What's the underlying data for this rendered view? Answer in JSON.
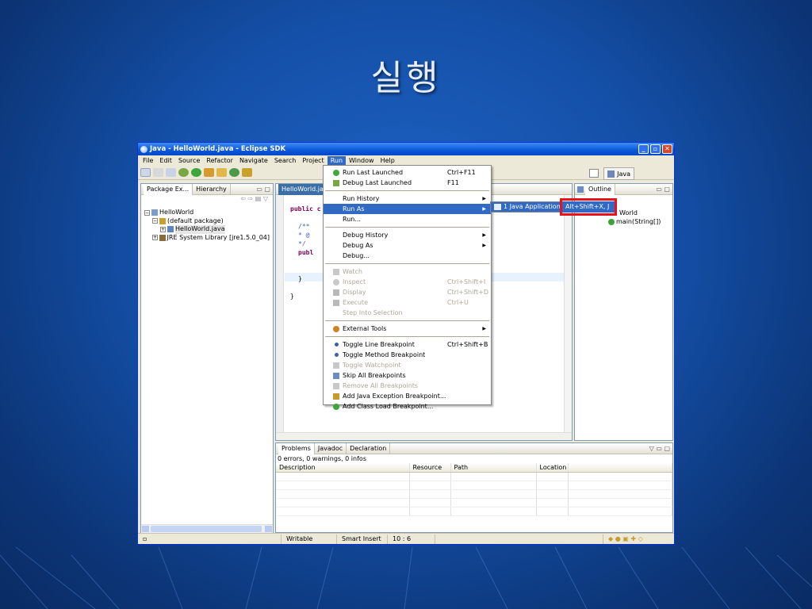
{
  "slide": {
    "title": "실행"
  },
  "window": {
    "title": "Java - HelloWorld.java - Eclipse SDK"
  },
  "menubar": [
    "File",
    "Edit",
    "Source",
    "Refactor",
    "Navigate",
    "Search",
    "Project",
    "Run",
    "Window",
    "Help"
  ],
  "perspective": {
    "label": "Java"
  },
  "package_explorer": {
    "tabs": [
      "Package Ex...",
      "Hierarchy"
    ],
    "tree": [
      {
        "label": "HelloWorld",
        "indent": 0
      },
      {
        "label": "(default package)",
        "indent": 1
      },
      {
        "label": "HelloWorld.java",
        "indent": 2
      },
      {
        "label": "JRE System Library [jre1.5.0_04]",
        "indent": 1
      }
    ]
  },
  "editor": {
    "tab": "HelloWorld.ja",
    "lines": [
      "public c",
      "",
      "/**",
      "  * @",
      "  */",
      "publ",
      "",
      "",
      "}",
      "",
      "}"
    ]
  },
  "outline": {
    "tab": "Outline",
    "items": [
      "World",
      "main(String[])"
    ]
  },
  "run_menu": [
    {
      "label": "Run Last Launched",
      "accel": "Ctrl+F11",
      "icon": "run-last-icon"
    },
    {
      "label": "Debug Last Launched",
      "accel": "F11",
      "icon": "debug-last-icon"
    },
    {
      "sep": true
    },
    {
      "label": "Run History",
      "submenu": true
    },
    {
      "label": "Run As",
      "submenu": true,
      "active": true
    },
    {
      "label": "Run..."
    },
    {
      "sep": true
    },
    {
      "label": "Debug History",
      "submenu": true
    },
    {
      "label": "Debug As",
      "submenu": true
    },
    {
      "label": "Debug..."
    },
    {
      "sep": true
    },
    {
      "label": "Watch",
      "disabled": true,
      "icon": "watch-icon"
    },
    {
      "label": "Inspect",
      "accel": "Ctrl+Shift+I",
      "disabled": true,
      "icon": "inspect-icon"
    },
    {
      "label": "Display",
      "accel": "Ctrl+Shift+D",
      "disabled": true,
      "icon": "display-icon"
    },
    {
      "label": "Execute",
      "accel": "Ctrl+U",
      "disabled": true,
      "icon": "execute-icon"
    },
    {
      "label": "Step Into Selection",
      "disabled": true
    },
    {
      "sep": true
    },
    {
      "label": "External Tools",
      "submenu": true,
      "icon": "external-tools-icon"
    },
    {
      "sep": true
    },
    {
      "label": "Toggle Line Breakpoint",
      "accel": "Ctrl+Shift+B",
      "icon": "breakpoint-icon"
    },
    {
      "label": "Toggle Method Breakpoint",
      "icon": "method-breakpoint-icon"
    },
    {
      "label": "Toggle Watchpoint",
      "disabled": true,
      "icon": "watchpoint-icon"
    },
    {
      "label": "Skip All Breakpoints",
      "icon": "skip-breakpoints-icon"
    },
    {
      "label": "Remove All Breakpoints",
      "disabled": true,
      "icon": "remove-breakpoints-icon"
    },
    {
      "label": "Add Java Exception Breakpoint...",
      "icon": "exception-breakpoint-icon"
    },
    {
      "label": "Add Class Load Breakpoint...",
      "icon": "class-load-breakpoint-icon"
    }
  ],
  "run_as_submenu": {
    "label": "1 Java Application"
  },
  "shortcut_submenu": {
    "label": "Alt+Shift+X, J"
  },
  "problems": {
    "tabs": [
      "Problems",
      "Javadoc",
      "Declaration"
    ],
    "summary": "0 errors, 0 warnings, 0 infos",
    "columns": [
      "Description",
      "Resource",
      "Path",
      "Location"
    ]
  },
  "status": {
    "writable": "Writable",
    "insert_mode": "Smart Insert",
    "position": "10 : 6"
  },
  "colors": {
    "menu_highlight": "#316ac5",
    "callout_border": "#e8121e",
    "titlebar": "#0a57d9"
  }
}
